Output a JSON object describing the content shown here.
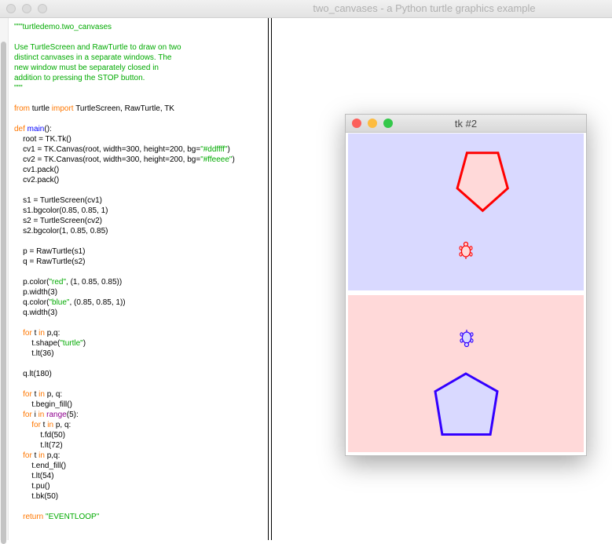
{
  "main_window": {
    "title": "two_canvases - a Python turtle graphics example"
  },
  "code_lines": [
    [
      {
        "t": "\"\"\"turtledemo.two_canvases",
        "c": "green"
      }
    ],
    [],
    [
      {
        "t": "Use TurtleScreen and RawTurtle to draw on two",
        "c": "green"
      }
    ],
    [
      {
        "t": "distinct canvases in a separate windows. The",
        "c": "green"
      }
    ],
    [
      {
        "t": "new window must be separately closed in",
        "c": "green"
      }
    ],
    [
      {
        "t": "addition to pressing the STOP button.",
        "c": "green"
      }
    ],
    [
      {
        "t": "\"\"\"",
        "c": "green"
      }
    ],
    [],
    [
      {
        "t": "from",
        "c": "keyword"
      },
      {
        "t": " turtle ",
        "c": "plain"
      },
      {
        "t": "import",
        "c": "keyword"
      },
      {
        "t": " TurtleScreen, RawTurtle, TK",
        "c": "plain"
      }
    ],
    [],
    [
      {
        "t": "def",
        "c": "keyword"
      },
      {
        "t": " main",
        "c": "def"
      },
      {
        "t": "():",
        "c": "plain"
      }
    ],
    [
      {
        "t": "    root = TK.Tk()",
        "c": "plain"
      }
    ],
    [
      {
        "t": "    cv1 = TK.Canvas(root, width=300, height=200, bg=",
        "c": "plain"
      },
      {
        "t": "\"#ddffff\"",
        "c": "green"
      },
      {
        "t": ")",
        "c": "plain"
      }
    ],
    [
      {
        "t": "    cv2 = TK.Canvas(root, width=300, height=200, bg=",
        "c": "plain"
      },
      {
        "t": "\"#ffeeee\"",
        "c": "green"
      },
      {
        "t": ")",
        "c": "plain"
      }
    ],
    [
      {
        "t": "    cv1.pack()",
        "c": "plain"
      }
    ],
    [
      {
        "t": "    cv2.pack()",
        "c": "plain"
      }
    ],
    [],
    [
      {
        "t": "    s1 = TurtleScreen(cv1)",
        "c": "plain"
      }
    ],
    [
      {
        "t": "    s1.bgcolor(0.85, 0.85, 1)",
        "c": "plain"
      }
    ],
    [
      {
        "t": "    s2 = TurtleScreen(cv2)",
        "c": "plain"
      }
    ],
    [
      {
        "t": "    s2.bgcolor(1, 0.85, 0.85)",
        "c": "plain"
      }
    ],
    [],
    [
      {
        "t": "    p = RawTurtle(s1)",
        "c": "plain"
      }
    ],
    [
      {
        "t": "    q = RawTurtle(s2)",
        "c": "plain"
      }
    ],
    [],
    [
      {
        "t": "    p.color(",
        "c": "plain"
      },
      {
        "t": "\"red\"",
        "c": "green"
      },
      {
        "t": ", (1, 0.85, 0.85))",
        "c": "plain"
      }
    ],
    [
      {
        "t": "    p.width(3)",
        "c": "plain"
      }
    ],
    [
      {
        "t": "    q.color(",
        "c": "plain"
      },
      {
        "t": "\"blue\"",
        "c": "green"
      },
      {
        "t": ", (0.85, 0.85, 1))",
        "c": "plain"
      }
    ],
    [
      {
        "t": "    q.width(3)",
        "c": "plain"
      }
    ],
    [],
    [
      {
        "t": "    ",
        "c": "plain"
      },
      {
        "t": "for",
        "c": "keyword"
      },
      {
        "t": " t ",
        "c": "plain"
      },
      {
        "t": "in",
        "c": "keyword"
      },
      {
        "t": " p,q:",
        "c": "plain"
      }
    ],
    [
      {
        "t": "        t.shape(",
        "c": "plain"
      },
      {
        "t": "\"turtle\"",
        "c": "green"
      },
      {
        "t": ")",
        "c": "plain"
      }
    ],
    [
      {
        "t": "        t.lt(36)",
        "c": "plain"
      }
    ],
    [],
    [
      {
        "t": "    q.lt(180)",
        "c": "plain"
      }
    ],
    [],
    [
      {
        "t": "    ",
        "c": "plain"
      },
      {
        "t": "for",
        "c": "keyword"
      },
      {
        "t": " t ",
        "c": "plain"
      },
      {
        "t": "in",
        "c": "keyword"
      },
      {
        "t": " p, q:",
        "c": "plain"
      }
    ],
    [
      {
        "t": "        t.begin_fill()",
        "c": "plain"
      }
    ],
    [
      {
        "t": "    ",
        "c": "plain"
      },
      {
        "t": "for",
        "c": "keyword"
      },
      {
        "t": " i ",
        "c": "plain"
      },
      {
        "t": "in",
        "c": "keyword"
      },
      {
        "t": " ",
        "c": "plain"
      },
      {
        "t": "range",
        "c": "builtin"
      },
      {
        "t": "(5):",
        "c": "plain"
      }
    ],
    [
      {
        "t": "        ",
        "c": "plain"
      },
      {
        "t": "for",
        "c": "keyword"
      },
      {
        "t": " t ",
        "c": "plain"
      },
      {
        "t": "in",
        "c": "keyword"
      },
      {
        "t": " p, q:",
        "c": "plain"
      }
    ],
    [
      {
        "t": "            t.fd(50)",
        "c": "plain"
      }
    ],
    [
      {
        "t": "            t.lt(72)",
        "c": "plain"
      }
    ],
    [
      {
        "t": "    ",
        "c": "plain"
      },
      {
        "t": "for",
        "c": "keyword"
      },
      {
        "t": " t ",
        "c": "plain"
      },
      {
        "t": "in",
        "c": "keyword"
      },
      {
        "t": " p,q:",
        "c": "plain"
      }
    ],
    [
      {
        "t": "        t.end_fill()",
        "c": "plain"
      }
    ],
    [
      {
        "t": "        t.lt(54)",
        "c": "plain"
      }
    ],
    [
      {
        "t": "        t.pu()",
        "c": "plain"
      }
    ],
    [
      {
        "t": "        t.bk(50)",
        "c": "plain"
      }
    ],
    [],
    [
      {
        "t": "    ",
        "c": "plain"
      },
      {
        "t": "return",
        "c": "keyword"
      },
      {
        "t": " ",
        "c": "plain"
      },
      {
        "t": "\"EVENTLOOP\"",
        "c": "green"
      }
    ]
  ],
  "syntax_colors": {
    "plain": "#000000",
    "green": "#00aa00",
    "keyword": "#ff7700",
    "def": "#0000ff",
    "builtin": "#900090"
  },
  "tk_window": {
    "title": "tk #2",
    "top_canvas": {
      "bg": "#d9d9ff",
      "pen_color": "#ff0000",
      "fill_color": "#ffd9d9",
      "pen_width": 3,
      "shape": "pentagon-icon",
      "turtle_icon": "turtle-icon"
    },
    "bottom_canvas": {
      "bg": "#ffd9d9",
      "pen_color": "#3300ff",
      "fill_color": "#d9d9ff",
      "pen_width": 3,
      "shape": "pentagon-icon",
      "turtle_icon": "turtle-icon"
    }
  },
  "window_buttons": {
    "close": "#fc605b",
    "minimize": "#fdbc40",
    "zoom": "#34c84a"
  }
}
